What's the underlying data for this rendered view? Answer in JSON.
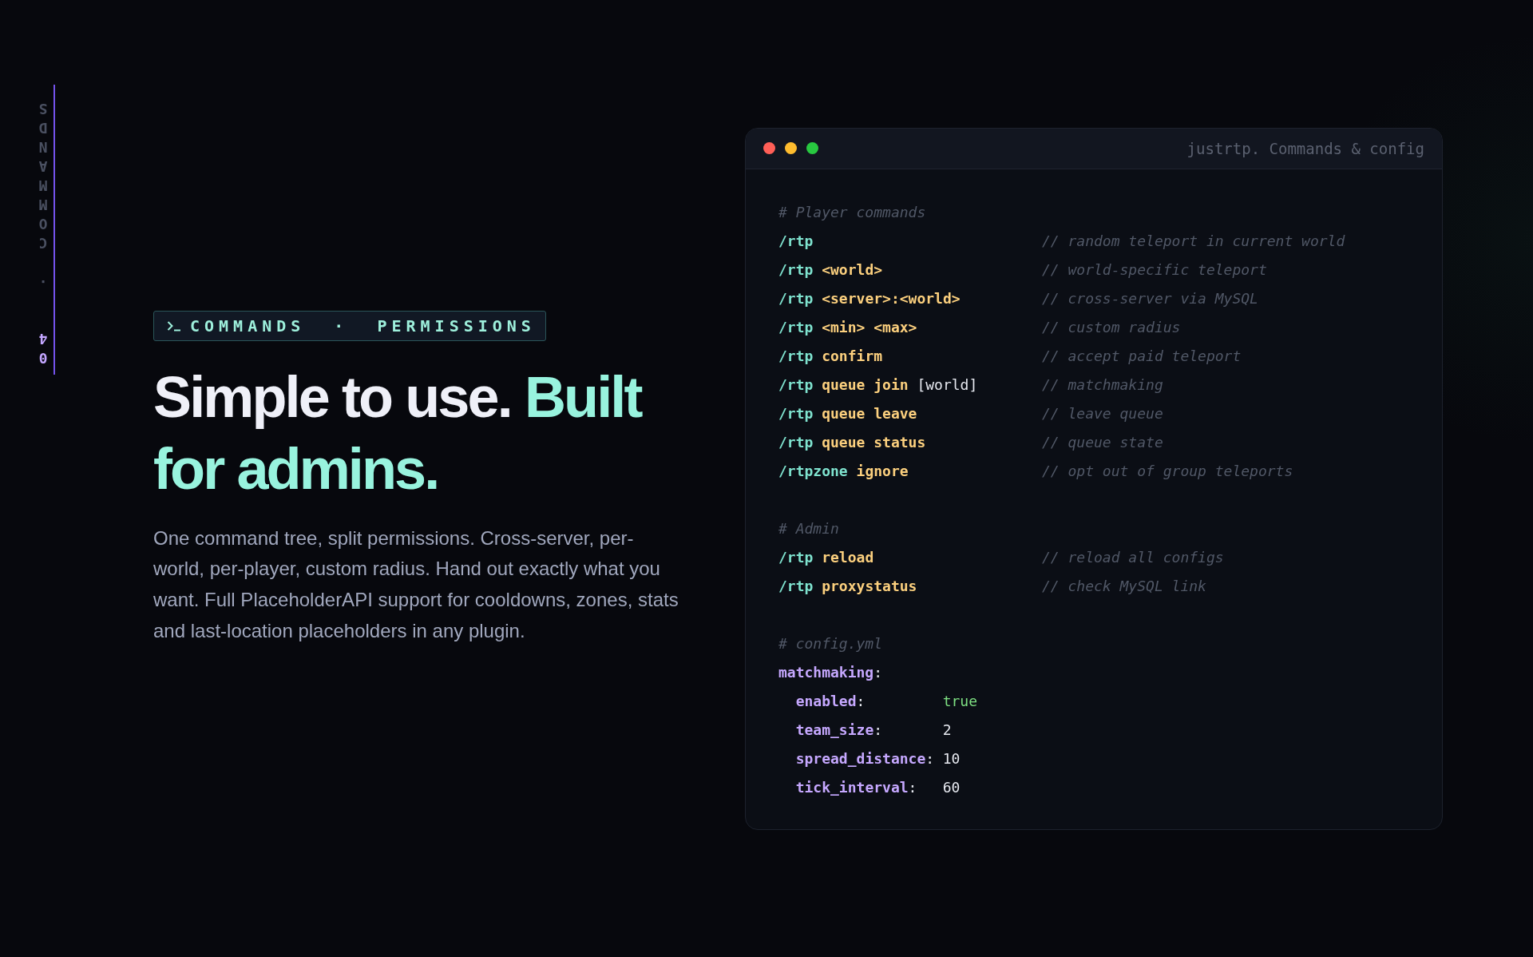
{
  "side_rail": {
    "number": "04",
    "separator": "·",
    "title": "COMMANDS"
  },
  "badge": {
    "label": "COMMANDS · PERMISSIONS"
  },
  "headline": {
    "text": "Simple to use.",
    "highlight": "Built for admins."
  },
  "description": "One command tree, split permissions. Cross-server, per-world, per-player, custom radius. Hand out exactly what you want. Full PlaceholderAPI support for cooldowns, zones, stats and last-location placeholders in any plugin.",
  "terminal": {
    "title": "justrtp. Commands & config",
    "sections": [
      {
        "kind": "commands",
        "heading": "# Player commands",
        "lines": [
          {
            "command": "/rtp",
            "comment": "// random teleport in current world"
          },
          {
            "command": "/rtp",
            "args": "<world>",
            "comment": "// world-specific teleport"
          },
          {
            "command": "/rtp",
            "args": "<server>:<world>",
            "comment": "// cross-server via MySQL"
          },
          {
            "command": "/rtp",
            "args": "<min> <max>",
            "comment": "// custom radius"
          },
          {
            "command": "/rtp",
            "args": "confirm",
            "comment": "// accept paid teleport"
          },
          {
            "command": "/rtp",
            "args": "queue join",
            "optional": "[world]",
            "comment": "// matchmaking"
          },
          {
            "command": "/rtp",
            "args": "queue leave",
            "comment": "// leave queue"
          },
          {
            "command": "/rtp",
            "args": "queue status",
            "comment": "// queue state"
          },
          {
            "command": "/rtpzone",
            "args": "ignore",
            "comment": "// opt out of group teleports"
          }
        ]
      },
      {
        "kind": "commands",
        "heading": "# Admin",
        "lines": [
          {
            "command": "/rtp",
            "args": "reload",
            "comment": "// reload all configs"
          },
          {
            "command": "/rtp",
            "args": "proxystatus",
            "comment": "// check MySQL link"
          }
        ]
      },
      {
        "kind": "config",
        "heading": "# config.yml",
        "root": {
          "key": "matchmaking",
          "separator": ":"
        },
        "entries": [
          {
            "key": "enabled",
            "separator": ":",
            "value": "true",
            "kind": "boolean"
          },
          {
            "key": "team_size",
            "separator": ":",
            "value": "2",
            "kind": "number"
          },
          {
            "key": "spread_distance",
            "separator": ":",
            "value": "10",
            "kind": "number"
          },
          {
            "key": "tick_interval",
            "separator": ":",
            "value": "60",
            "kind": "number"
          }
        ]
      }
    ]
  }
}
